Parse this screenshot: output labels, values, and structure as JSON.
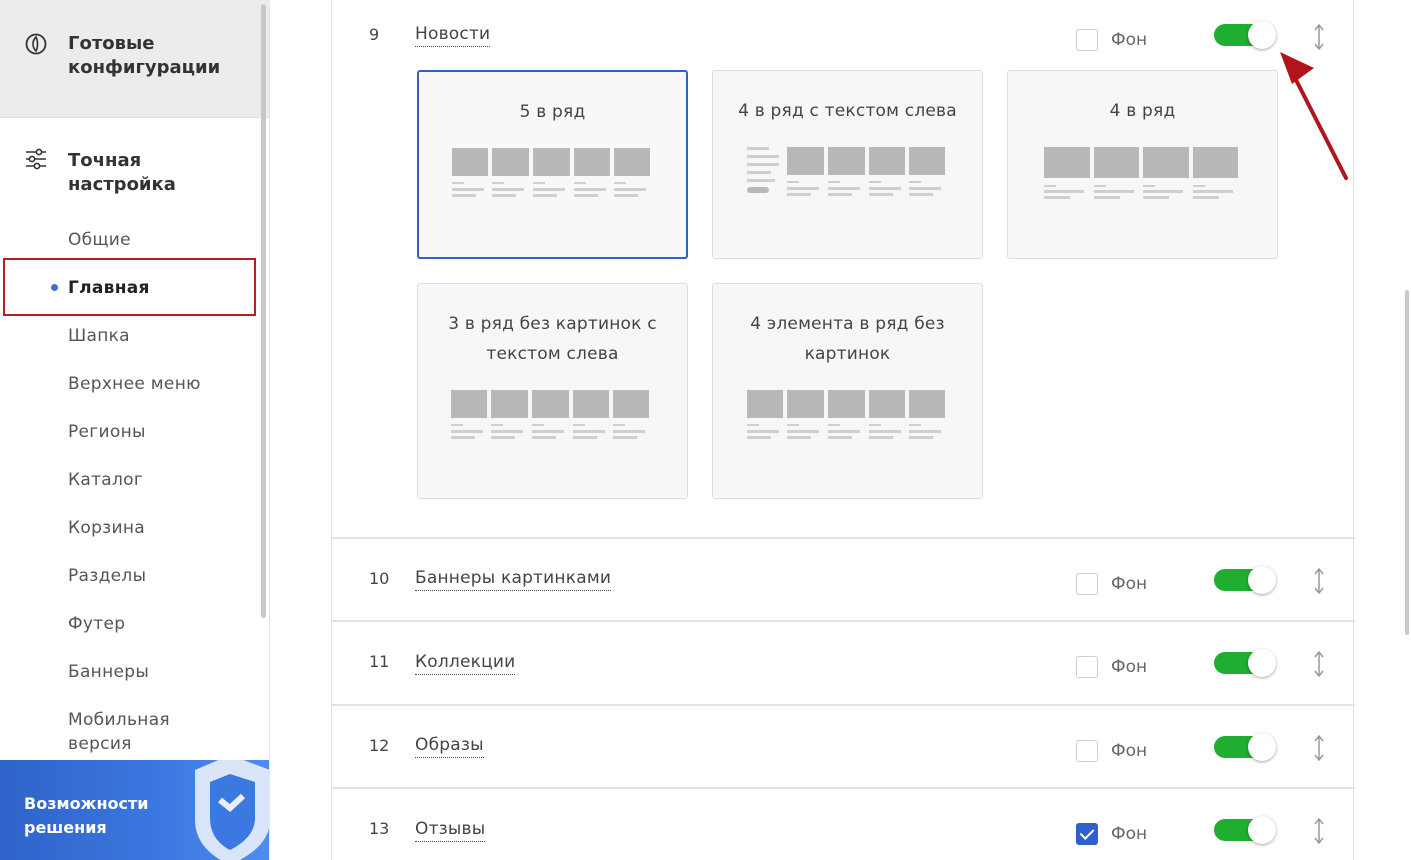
{
  "sidebar": {
    "ready_title": "Готовые конфигурации",
    "fine_title": "Точная настройка",
    "items": [
      {
        "label": "Общие"
      },
      {
        "label": "Главная",
        "active": true
      },
      {
        "label": "Шапка"
      },
      {
        "label": "Верхнее меню"
      },
      {
        "label": "Регионы"
      },
      {
        "label": "Каталог"
      },
      {
        "label": "Корзина"
      },
      {
        "label": "Разделы"
      },
      {
        "label": "Футер"
      },
      {
        "label": "Баннеры"
      },
      {
        "label": "Мобильная версия"
      }
    ],
    "banner_text": "Возможности решения"
  },
  "blocks": [
    {
      "num": "9",
      "title": "Новости",
      "fon_label": "Фон",
      "fon_checked": false,
      "enabled": true
    },
    {
      "num": "10",
      "title": "Баннеры картинками",
      "fon_label": "Фон",
      "fon_checked": false,
      "enabled": true
    },
    {
      "num": "11",
      "title": "Коллекции",
      "fon_label": "Фон",
      "fon_checked": false,
      "enabled": true
    },
    {
      "num": "12",
      "title": "Образы",
      "fon_label": "Фон",
      "fon_checked": false,
      "enabled": true
    },
    {
      "num": "13",
      "title": "Отзывы",
      "fon_label": "Фон",
      "fon_checked": true,
      "enabled": true
    }
  ],
  "layouts": [
    {
      "label": "5 в ряд",
      "selected": true
    },
    {
      "label": "4 в ряд с текстом слева",
      "selected": false
    },
    {
      "label": "4 в ряд",
      "selected": false
    },
    {
      "label": "3 в ряд без картинок с текстом слева",
      "selected": false
    },
    {
      "label": "4 элемента в ряд без картинок",
      "selected": false
    }
  ],
  "colors": {
    "toggle_on": "#1fae30",
    "checkbox_on": "#2f5fcf",
    "selected_border": "#3560c4",
    "highlight_box": "#b52025",
    "annotation_arrow": "#b0151b",
    "banner": "#3b78e0"
  }
}
